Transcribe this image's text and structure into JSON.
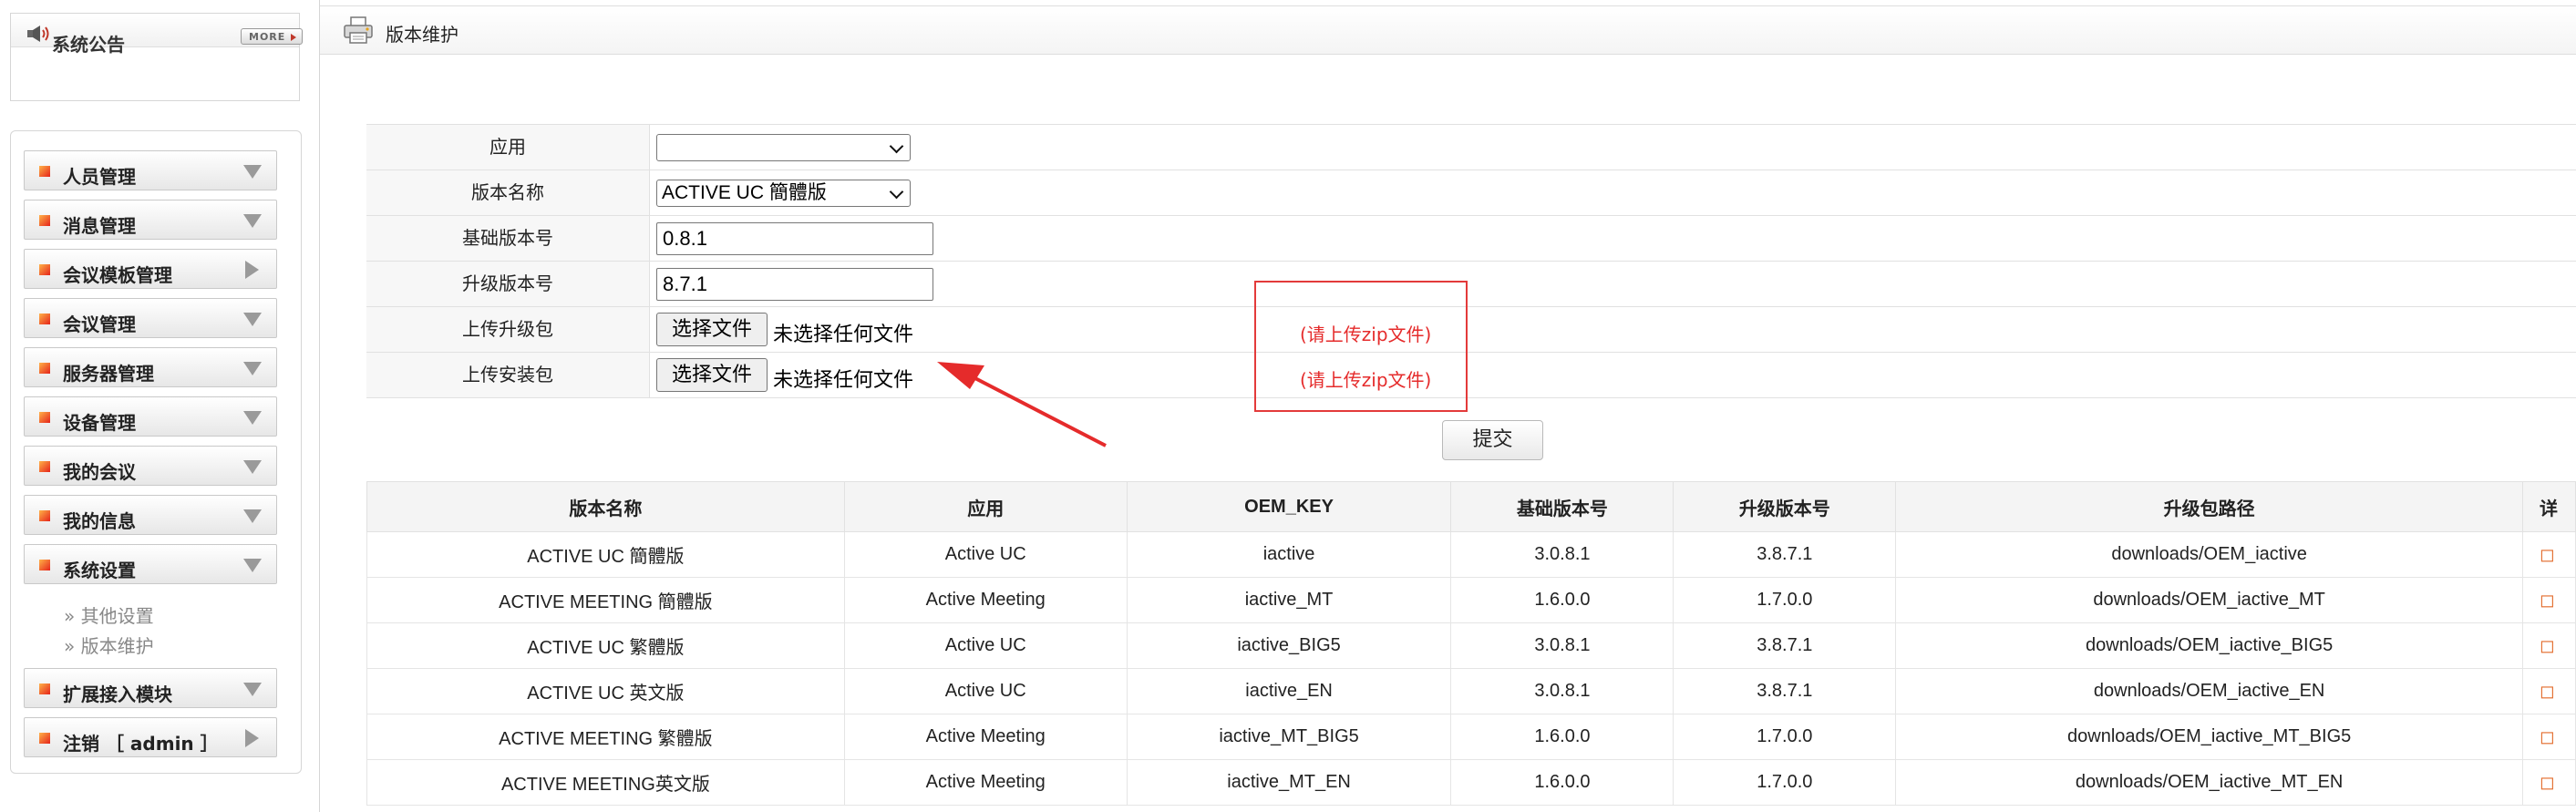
{
  "notice": {
    "title": "系统公告",
    "more_label": "MORE"
  },
  "menu": {
    "items": [
      {
        "label": "人员管理",
        "arrow": "down"
      },
      {
        "label": "消息管理",
        "arrow": "down"
      },
      {
        "label": "会议模板管理",
        "arrow": "right"
      },
      {
        "label": "会议管理",
        "arrow": "down"
      },
      {
        "label": "服务器管理",
        "arrow": "down"
      },
      {
        "label": "设备管理",
        "arrow": "down"
      },
      {
        "label": "我的会议",
        "arrow": "down"
      },
      {
        "label": "我的信息",
        "arrow": "down"
      },
      {
        "label": "系统设置",
        "arrow": "down"
      },
      {
        "label": "扩展接入模块",
        "arrow": "down"
      },
      {
        "label": "注销 ［ admin ］",
        "arrow": "right"
      }
    ],
    "sub_items": [
      "» 其他设置",
      "» 版本维护"
    ]
  },
  "page": {
    "title": "版本维护"
  },
  "form": {
    "app_label": "应用",
    "app_value": "",
    "version_name_label": "版本名称",
    "version_name_value": "ACTIVE UC 簡體版",
    "base_version_label": "基础版本号",
    "base_version_value": "0.8.1",
    "upgrade_version_label": "升级版本号",
    "upgrade_version_value": "8.7.1",
    "upgrade_pkg_label": "上传升级包",
    "install_pkg_label": "上传安装包",
    "choose_file_label": "选择文件",
    "no_file_text": "未选择任何文件",
    "zip_hint": "(请上传zip文件)",
    "submit_label": "提交"
  },
  "table": {
    "headers": [
      "版本名称",
      "应用",
      "OEM_KEY",
      "基础版本号",
      "升级版本号",
      "升级包路径",
      "详"
    ],
    "rows": [
      [
        "ACTIVE UC 簡體版",
        "Active UC",
        "iactive",
        "3.0.8.1",
        "3.8.7.1",
        "downloads/OEM_iactive"
      ],
      [
        "ACTIVE MEETING 簡體版",
        "Active Meeting",
        "iactive_MT",
        "1.6.0.0",
        "1.7.0.0",
        "downloads/OEM_iactive_MT"
      ],
      [
        "ACTIVE UC 繁體版",
        "Active UC",
        "iactive_BIG5",
        "3.0.8.1",
        "3.8.7.1",
        "downloads/OEM_iactive_BIG5"
      ],
      [
        "ACTIVE UC 英文版",
        "Active UC",
        "iactive_EN",
        "3.0.8.1",
        "3.8.7.1",
        "downloads/OEM_iactive_EN"
      ],
      [
        "ACTIVE MEETING 繁體版",
        "Active Meeting",
        "iactive_MT_BIG5",
        "1.6.0.0",
        "1.7.0.0",
        "downloads/OEM_iactive_MT_BIG5"
      ],
      [
        "ACTIVE MEETING英文版",
        "Active Meeting",
        "iactive_MT_EN",
        "1.6.0.0",
        "1.7.0.0",
        "downloads/OEM_iactive_MT_EN"
      ]
    ]
  },
  "colors": {
    "accent_red": "#e52b2b",
    "menu_square": "#e5231b"
  }
}
